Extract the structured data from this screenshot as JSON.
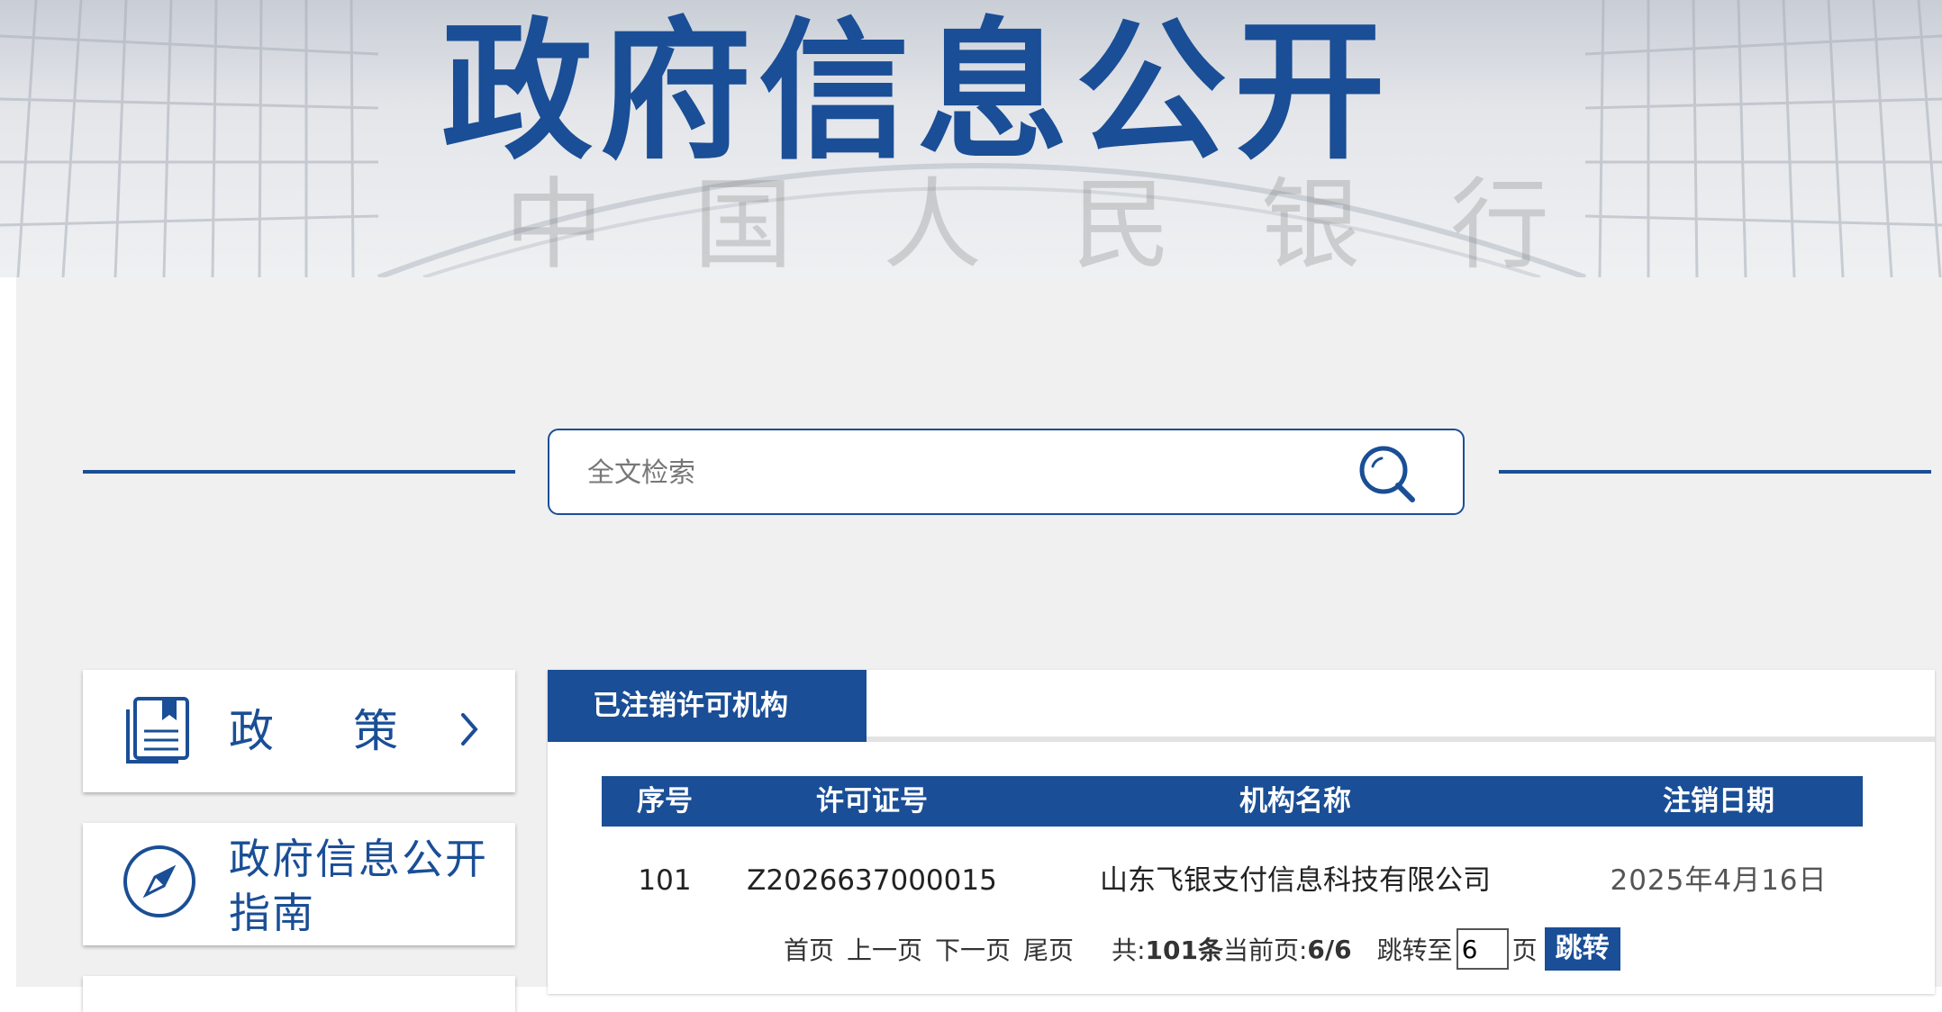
{
  "banner": {
    "title": "政府信息公开",
    "background_chars": [
      "中",
      "国",
      "人",
      "民",
      "银",
      "行"
    ]
  },
  "search": {
    "placeholder": "全文检索",
    "icon": "search-icon"
  },
  "nav": {
    "items": [
      {
        "label": "政策",
        "icon": "document-stack-icon",
        "chevron": "chevron-right-icon"
      },
      {
        "label": "政府信息公开指南",
        "icon": "compass-icon"
      }
    ]
  },
  "panel": {
    "tab_label": "已注销许可机构",
    "table": {
      "headers": [
        "序号",
        "许可证号",
        "机构名称",
        "注销日期"
      ],
      "rows": [
        [
          "101",
          "Z2026637000015",
          "山东飞银支付信息科技有限公司",
          "2025年4月16日"
        ]
      ]
    },
    "pager": {
      "first": "首页",
      "prev": "上一页",
      "next": "下一页",
      "last": "尾页",
      "total_prefix": "共:",
      "total_value": "101条",
      "current_prefix": "当前页:",
      "current_value": "6/6",
      "jump_label": "跳转至",
      "jump_value": "6",
      "page_suffix": "页",
      "jump_button": "跳转"
    }
  },
  "colors": {
    "primary": "#1a4e96",
    "panel_bg": "#f0f0f0"
  }
}
